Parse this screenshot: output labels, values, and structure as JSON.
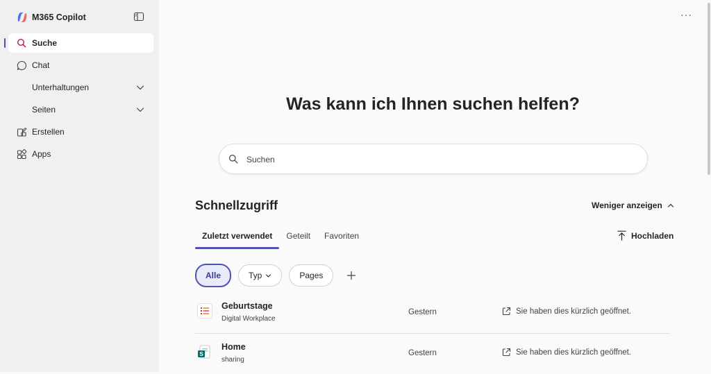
{
  "app": {
    "title": "M365 Copilot"
  },
  "sidebar": {
    "items": [
      {
        "label": "Suche",
        "icon": "search-icon",
        "active": true
      },
      {
        "label": "Chat",
        "icon": "chat-icon"
      },
      {
        "label": "Unterhaltungen",
        "expandable": true
      },
      {
        "label": "Seiten",
        "expandable": true
      },
      {
        "label": "Erstellen",
        "icon": "create-icon"
      },
      {
        "label": "Apps",
        "icon": "apps-icon"
      }
    ]
  },
  "main": {
    "heading": "Was kann ich Ihnen suchen helfen?",
    "search": {
      "placeholder": "Suchen",
      "value": ""
    },
    "quick_access": {
      "title": "Schnellzugriff",
      "toggle_label": "Weniger anzeigen",
      "tabs": [
        {
          "label": "Zuletzt verwendet",
          "active": true
        },
        {
          "label": "Geteilt"
        },
        {
          "label": "Favoriten"
        }
      ],
      "upload_label": "Hochladen",
      "filters": [
        {
          "label": "Alle",
          "active": true
        },
        {
          "label": "Typ",
          "dropdown": true
        },
        {
          "label": "Pages"
        }
      ],
      "files": [
        {
          "name": "Geburtstage",
          "location": "Digital Workplace",
          "date": "Gestern",
          "activity": "Sie haben dies kürzlich geöffnet.",
          "icon": "list-icon"
        },
        {
          "name": "Home",
          "location": "sharing",
          "date": "Gestern",
          "activity": "Sie haben dies kürzlich geöffnet.",
          "icon": "sharepoint-icon"
        }
      ]
    }
  },
  "colors": {
    "accent": "#4f52b2",
    "sidebar_bg": "#f0f0f0",
    "page_bg": "#fafafa"
  }
}
